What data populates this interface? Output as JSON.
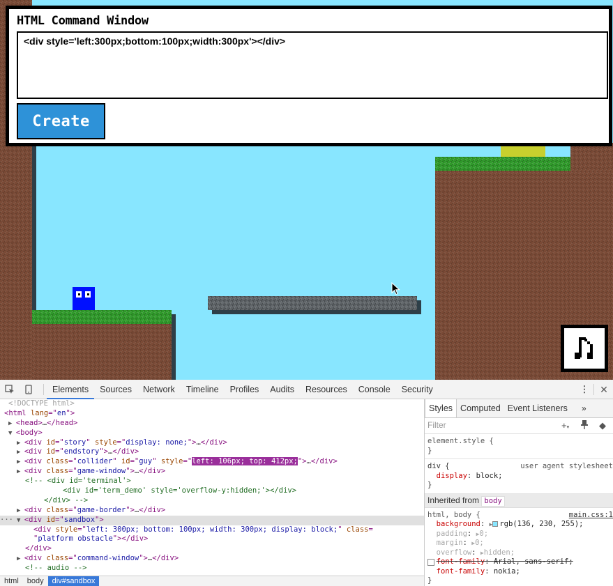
{
  "command_window": {
    "title": "HTML Command Window",
    "input_value": "<div style='left:300px;bottom:100px;width:300px'></div>",
    "create_label": "Create"
  },
  "game": {
    "sky_color": "#88e6ff",
    "dirt_color": "#7a4a36",
    "grass_color": "#2f9a2a",
    "player_color": "#0010ff",
    "music_icon": "music-note-icon"
  },
  "devtools": {
    "tabs": [
      "Elements",
      "Sources",
      "Network",
      "Timeline",
      "Profiles",
      "Audits",
      "Resources",
      "Console",
      "Security"
    ],
    "active_tab": "Elements",
    "dom": {
      "doctype": "<!DOCTYPE html>",
      "html_open": [
        "<html",
        " lang",
        "=\"",
        "en",
        "\">"
      ],
      "head": "…",
      "body": "<body>",
      "story": {
        "id": "story",
        "style": "display: none;"
      },
      "endstory": {
        "id": "endstory"
      },
      "guy": {
        "class": "collider",
        "id": "guy",
        "style": "left: 106px; top: 412px;"
      },
      "game_window": {
        "class": "game-window"
      },
      "comment1": "<!-- <div id='terminal'>",
      "comment2": "<div id='term_demo' style='overflow-y:hidden;'></div>",
      "comment3": "</div> -->",
      "game_border": {
        "class": "game-border"
      },
      "sandbox": {
        "id": "sandbox"
      },
      "sandbox_child": {
        "style": "left: 300px; bottom: 100px; width: 300px; display: block;",
        "class": "platform obstacle"
      },
      "command_window": {
        "class": "command-window"
      },
      "audio_comment": "<!-- audio -->",
      "ellipsis": "…"
    },
    "breadcrumbs": [
      "html",
      "body",
      "div#sandbox"
    ],
    "styles": {
      "tabs": [
        "Styles",
        "Computed",
        "Event Listeners"
      ],
      "more": "»",
      "filter_placeholder": "Filter",
      "element_style": "element.style {",
      "close_brace": "}",
      "div_rule": {
        "selector": "div {",
        "origin": "user agent stylesheet",
        "prop": "display",
        "value": "block;"
      },
      "inherited_from_label": "Inherited from",
      "inherited_from_tag": "body",
      "body_rule": {
        "selector": "html, body {",
        "origin": "main.css:1",
        "props": [
          {
            "name": "background",
            "value": "rgb(136, 230, 255);",
            "dim": false
          },
          {
            "name": "padding",
            "value": "0;",
            "dim": true
          },
          {
            "name": "margin",
            "value": "0;",
            "dim": true
          },
          {
            "name": "overflow",
            "value": "hidden;",
            "dim": true
          },
          {
            "name": "font-family",
            "value": "Arial, sans-serif;",
            "dim": false,
            "struck": true
          },
          {
            "name": "font-family",
            "value": "nokia;",
            "dim": false
          }
        ]
      }
    }
  }
}
